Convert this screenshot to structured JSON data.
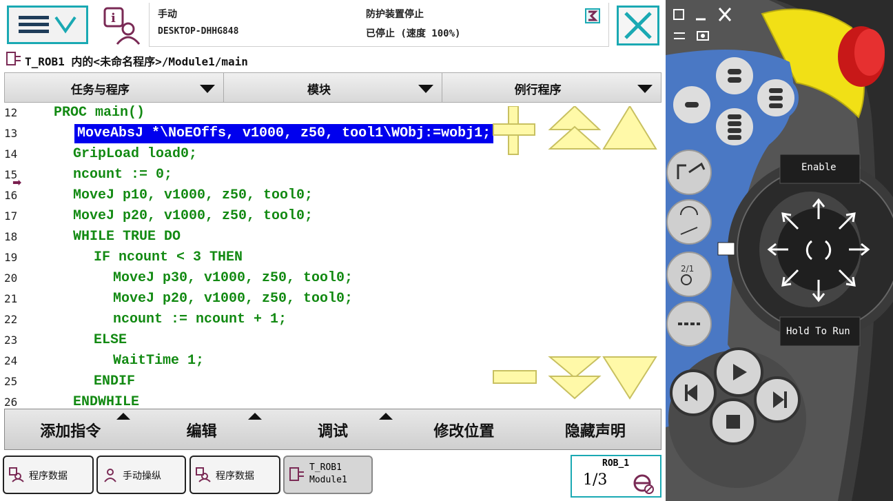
{
  "status": {
    "mode": "手动",
    "system_name": "DESKTOP-DHHG848",
    "safety": "防护装置停止",
    "run_state": "已停止 (速度 100%)"
  },
  "path": "T_ROB1 内的<未命名程序>/Module1/main",
  "dropdowns": [
    "任务与程序",
    "模块",
    "例行程序"
  ],
  "code_lines": [
    {
      "n": "12",
      "text": "PROC main()",
      "indent": 0
    },
    {
      "n": "13",
      "text": "MoveAbsJ *\\NoEOffs, v1000, z50, tool1\\WObj:=wobj1;",
      "indent": 1,
      "selected": true
    },
    {
      "n": "14",
      "text": "GripLoad load0;",
      "indent": 1
    },
    {
      "n": "15",
      "text": "ncount := 0;",
      "indent": 1,
      "pc": true
    },
    {
      "n": "16",
      "text": "MoveJ p10, v1000, z50, tool0;",
      "indent": 1
    },
    {
      "n": "17",
      "text": "MoveJ p20, v1000, z50, tool0;",
      "indent": 1
    },
    {
      "n": "18",
      "text": "WHILE TRUE DO",
      "indent": 1
    },
    {
      "n": "19",
      "text": "IF ncount < 3 THEN",
      "indent": 2
    },
    {
      "n": "20",
      "text": "MoveJ p30, v1000, z50, tool0;",
      "indent": 3
    },
    {
      "n": "21",
      "text": "MoveJ p20, v1000, z50, tool0;",
      "indent": 3
    },
    {
      "n": "22",
      "text": "ncount := ncount + 1;",
      "indent": 3
    },
    {
      "n": "23",
      "text": "ELSE",
      "indent": 2
    },
    {
      "n": "24",
      "text": "WaitTime 1;",
      "indent": 3
    },
    {
      "n": "25",
      "text": "ENDIF",
      "indent": 2
    },
    {
      "n": "26",
      "text": "ENDWHILE",
      "indent": 1
    }
  ],
  "toolbar": [
    "添加指令",
    "编辑",
    "调试",
    "修改位置",
    "隐藏声明"
  ],
  "tasks": [
    "程序数据",
    "手动操纵",
    "程序数据"
  ],
  "active_task": {
    "line1": "T_ROB1",
    "line2": "Module1"
  },
  "quickset": {
    "robot": "ROB_1",
    "fraction": "1/3"
  },
  "pendant": {
    "enable_label": "Enable",
    "hold_label": "Hold To Run"
  },
  "colors": {
    "accent": "#1aa9b3",
    "code": "#138a13",
    "selection": "#0000ee",
    "zoom_buttons": "#fff9a8"
  }
}
